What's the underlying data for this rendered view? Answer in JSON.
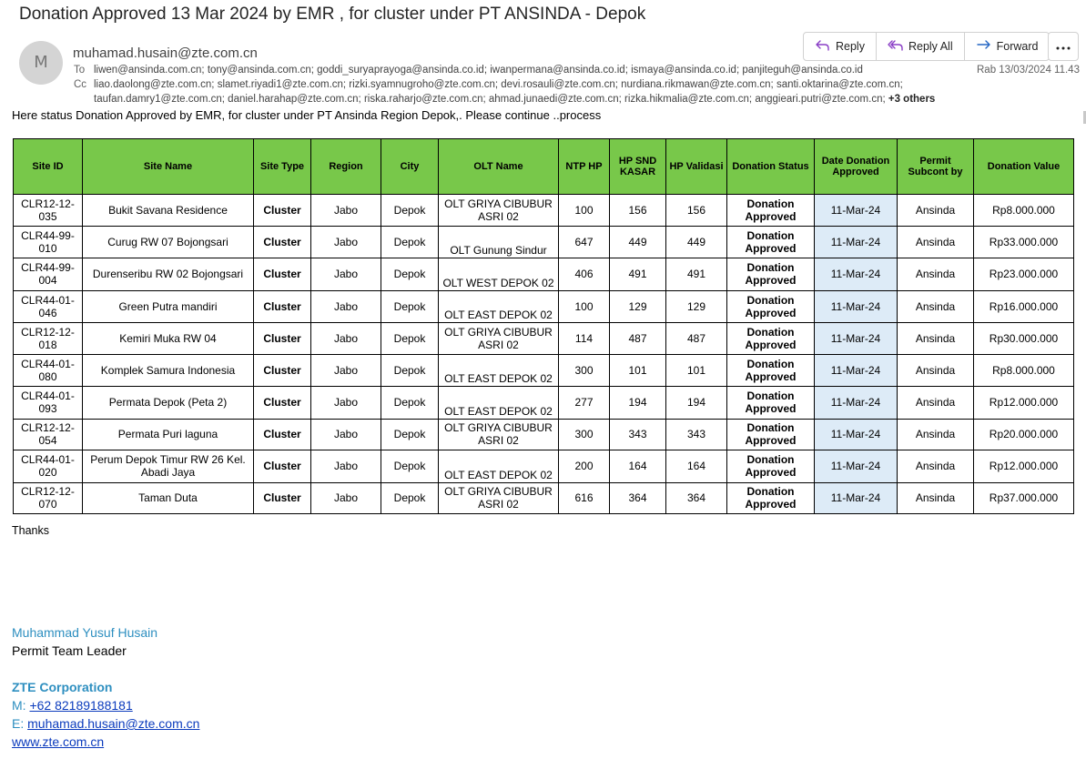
{
  "email": {
    "subject": "Donation Approved 13 Mar 2024 by EMR , for cluster under PT ANSINDA - Depok",
    "avatar_initial": "M",
    "sender": "muhamad.husain@zte.com.cn",
    "to_label": "To",
    "to": "liwen@ansinda.com.cn; tony@ansinda.com.cn; goddi_suryaprayoga@ansinda.co.id; iwanpermana@ansinda.co.id; ismaya@ansinda.co.id; panjiteguh@ansinda.co.id",
    "cc_label": "Cc",
    "cc_line1": "liao.daolong@zte.com.cn; slamet.riyadi1@zte.com.cn; rizki.syamnugroho@zte.com.cn; devi.rosauli@zte.com.cn; nurdiana.rikmawan@zte.com.cn; santi.oktarina@zte.com.cn;",
    "cc_line2": "taufan.damry1@zte.com.cn; daniel.harahap@zte.com.cn; riska.raharjo@zte.com.cn; ahmad.junaedi@zte.com.cn; rizka.hikmalia@zte.com.cn; anggieari.putri@zte.com.cn;",
    "cc_more": "+3 others",
    "date": "Rab 13/03/2024 11.43",
    "intro": "Here status Donation Approved by EMR, for cluster under PT Ansinda Region Depok,.  Please continue ..process",
    "thanks": "Thanks"
  },
  "actions": {
    "reply": "Reply",
    "reply_all": "Reply All",
    "forward": "Forward"
  },
  "icons": {
    "reply": "reply-arrow-icon",
    "reply_all": "reply-all-arrow-icon",
    "forward": "forward-arrow-icon",
    "more": "more-horizontal-icon"
  },
  "colors": {
    "header_green": "#78c84a",
    "date_cell_blue": "#ddebf7",
    "signature_blue": "#2e8fc0",
    "link_blue": "#0b3bbd",
    "reply_all_purple": "#8a3fc6",
    "accent_blue": "#2566c4"
  },
  "table": {
    "headers": [
      "Site ID",
      "Site Name",
      "Site Type",
      "Region",
      "City",
      "OLT Name",
      "NTP HP",
      "HP SND KASAR",
      "HP Validasi",
      "Donation Status",
      "Date Donation Approved",
      "Permit Subcont by",
      "Donation Value"
    ],
    "rows": [
      {
        "site_id": "CLR12-12-035",
        "site_name": "Bukit Savana Residence",
        "type": "Cluster",
        "region": "Jabo",
        "city": "Depok",
        "olt": "OLT GRIYA CIBUBUR ASRI 02",
        "ntp": "100",
        "snd": "156",
        "val": "156",
        "status": "Donation Approved",
        "date": "11-Mar-24",
        "subcont": "Ansinda",
        "value": "Rp8.000.000"
      },
      {
        "site_id": "CLR44-99-010",
        "site_name": "Curug RW 07 Bojongsari",
        "type": "Cluster",
        "region": "Jabo",
        "city": "Depok",
        "olt": "OLT Gunung Sindur",
        "ntp": "647",
        "snd": "449",
        "val": "449",
        "status": "Donation Approved",
        "date": "11-Mar-24",
        "subcont": "Ansinda",
        "value": "Rp33.000.000"
      },
      {
        "site_id": "CLR44-99-004",
        "site_name": "Durenseribu RW 02 Bojongsari",
        "type": "Cluster",
        "region": "Jabo",
        "city": "Depok",
        "olt": "OLT WEST DEPOK 02",
        "ntp": "406",
        "snd": "491",
        "val": "491",
        "status": "Donation Approved",
        "date": "11-Mar-24",
        "subcont": "Ansinda",
        "value": "Rp23.000.000"
      },
      {
        "site_id": "CLR44-01-046",
        "site_name": "Green Putra mandiri",
        "type": "Cluster",
        "region": "Jabo",
        "city": "Depok",
        "olt": "OLT EAST DEPOK 02",
        "ntp": "100",
        "snd": "129",
        "val": "129",
        "status": "Donation Approved",
        "date": "11-Mar-24",
        "subcont": "Ansinda",
        "value": "Rp16.000.000"
      },
      {
        "site_id": "CLR12-12-018",
        "site_name": "Kemiri Muka RW 04",
        "type": "Cluster",
        "region": "Jabo",
        "city": "Depok",
        "olt": "OLT GRIYA CIBUBUR ASRI 02",
        "ntp": "114",
        "snd": "487",
        "val": "487",
        "status": "Donation Approved",
        "date": "11-Mar-24",
        "subcont": "Ansinda",
        "value": "Rp30.000.000"
      },
      {
        "site_id": "CLR44-01-080",
        "site_name": "Komplek Samura Indonesia",
        "type": "Cluster",
        "region": "Jabo",
        "city": "Depok",
        "olt": "OLT EAST DEPOK 02",
        "ntp": "300",
        "snd": "101",
        "val": "101",
        "status": "Donation Approved",
        "date": "11-Mar-24",
        "subcont": "Ansinda",
        "value": "Rp8.000.000"
      },
      {
        "site_id": "CLR44-01-093",
        "site_name": "Permata Depok (Peta 2)",
        "type": "Cluster",
        "region": "Jabo",
        "city": "Depok",
        "olt": "OLT EAST DEPOK 02",
        "ntp": "277",
        "snd": "194",
        "val": "194",
        "status": "Donation Approved",
        "date": "11-Mar-24",
        "subcont": "Ansinda",
        "value": "Rp12.000.000"
      },
      {
        "site_id": "CLR12-12-054",
        "site_name": "Permata Puri laguna",
        "type": "Cluster",
        "region": "Jabo",
        "city": "Depok",
        "olt": "OLT GRIYA CIBUBUR ASRI 02",
        "ntp": "300",
        "snd": "343",
        "val": "343",
        "status": "Donation Approved",
        "date": "11-Mar-24",
        "subcont": "Ansinda",
        "value": "Rp20.000.000"
      },
      {
        "site_id": "CLR44-01-020",
        "site_name": "Perum Depok Timur RW 26 Kel. Abadi Jaya",
        "type": "Cluster",
        "region": "Jabo",
        "city": "Depok",
        "olt": "OLT EAST DEPOK 02",
        "ntp": "200",
        "snd": "164",
        "val": "164",
        "status": "Donation Approved",
        "date": "11-Mar-24",
        "subcont": "Ansinda",
        "value": "Rp12.000.000"
      },
      {
        "site_id": "CLR12-12-070",
        "site_name": "Taman Duta",
        "type": "Cluster",
        "region": "Jabo",
        "city": "Depok",
        "olt": "OLT GRIYA CIBUBUR ASRI 02",
        "ntp": "616",
        "snd": "364",
        "val": "364",
        "status": "Donation Approved",
        "date": "11-Mar-24",
        "subcont": "Ansinda",
        "value": "Rp37.000.000"
      }
    ]
  },
  "signature": {
    "name": "Muhammad Yusuf Husain",
    "title": "Permit Team Leader",
    "company": "ZTE Corporation",
    "mobile_label": "M:",
    "mobile": "+62 82189188181",
    "email_label": "E:",
    "email": "muhamad.husain@zte.com.cn",
    "website": "www.zte.com.cn"
  }
}
